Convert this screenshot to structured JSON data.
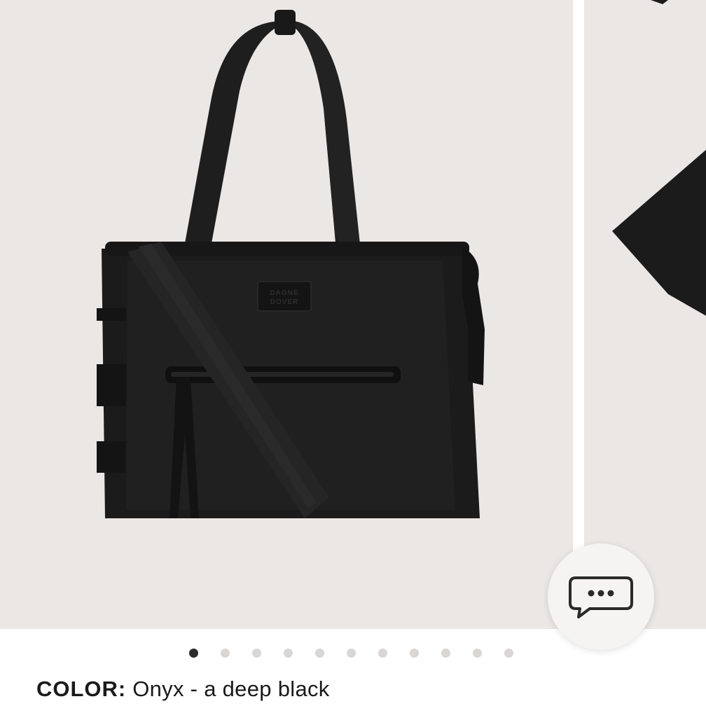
{
  "product": {
    "brand_patch_line1": "DAGNE",
    "brand_patch_line2": "DOVER",
    "color_label": "COLOR:",
    "color_value": "Onyx - a deep black"
  },
  "carousel": {
    "slide_count": 11,
    "active_index": 0
  },
  "colors": {
    "background": "#ebe7e5",
    "bag": "#1d1c1d",
    "dot_active": "#2b2b2b",
    "dot_inactive": "#dad6d4"
  },
  "chat": {
    "icon": "chat-bubble-icon"
  }
}
